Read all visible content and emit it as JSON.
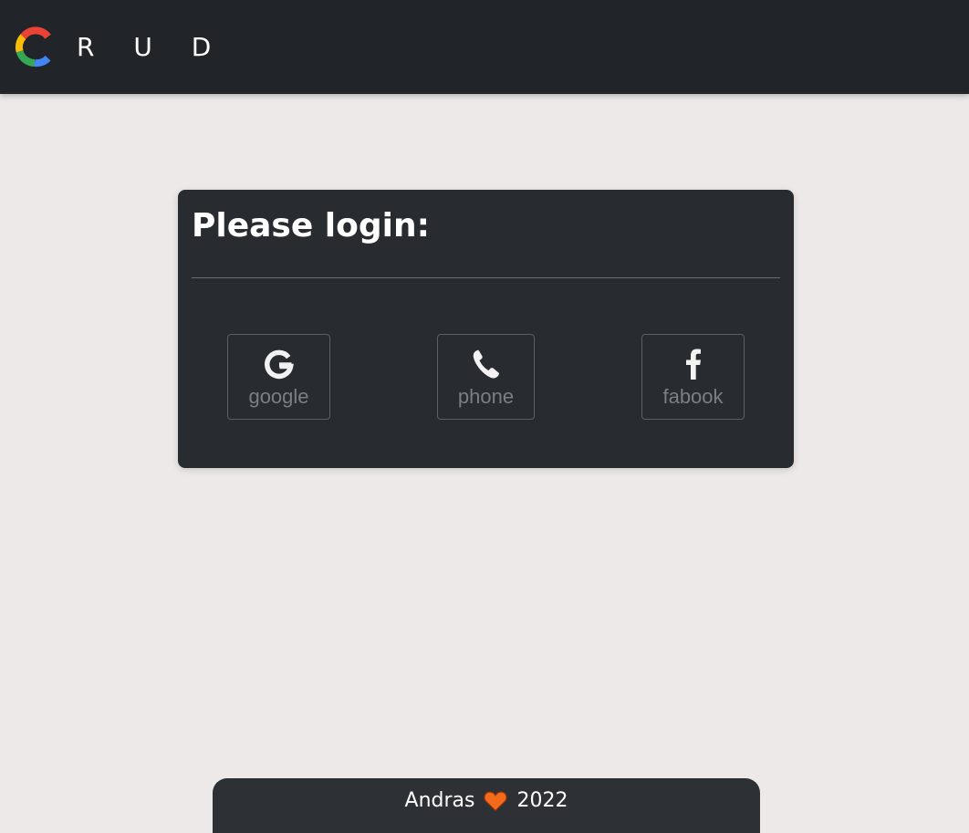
{
  "navbar": {
    "logo_icon": "multicolor-c-logo-icon",
    "brand_text": "R U D",
    "colors": {
      "background": "#212429",
      "logo_red": "#ea4335",
      "logo_yellow": "#fbbc05",
      "logo_green": "#34a853",
      "logo_blue": "#4285f4"
    }
  },
  "login_card": {
    "title": "Please login:",
    "buttons": [
      {
        "icon": "google-g-icon",
        "label": "google"
      },
      {
        "icon": "phone-icon",
        "label": "phone"
      },
      {
        "icon": "facebook-f-icon",
        "label": "fabook"
      }
    ]
  },
  "footer": {
    "author": "Andras",
    "heart_icon": "heart-icon",
    "heart_color": "#f26b1d",
    "year": "2022"
  }
}
